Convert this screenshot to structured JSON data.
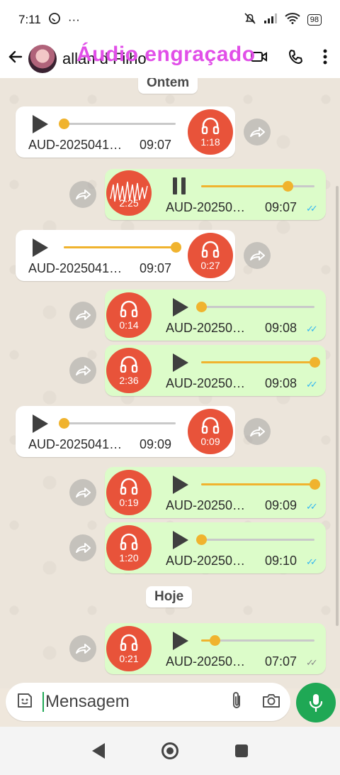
{
  "status_bar": {
    "time": "7:11",
    "dots": "···",
    "battery": "98"
  },
  "header": {
    "contact_name": "allan d Filho",
    "overlay_title": "Áudio engraçado"
  },
  "date_chips": {
    "yesterday": "Ontem",
    "today": "Hoje"
  },
  "messages": [
    {
      "direction": "in",
      "file": "AUD-2025041…",
      "time": "09:07",
      "duration": "1:18",
      "progress": 0.0,
      "state": "stopped"
    },
    {
      "direction": "out",
      "file": "AUD-20250…",
      "time": "09:07",
      "duration": "2:25",
      "progress": 0.76,
      "state": "playing",
      "read": true
    },
    {
      "direction": "in",
      "file": "AUD-2025041…",
      "time": "09:07",
      "duration": "0:27",
      "progress": 1.0,
      "state": "stopped"
    },
    {
      "direction": "out",
      "file": "AUD-20250…",
      "time": "09:08",
      "duration": "0:14",
      "progress": 0.0,
      "state": "stopped",
      "read": true
    },
    {
      "direction": "out",
      "file": "AUD-20250…",
      "time": "09:08",
      "duration": "2:36",
      "progress": 1.0,
      "state": "stopped",
      "read": true
    },
    {
      "direction": "in",
      "file": "AUD-2025041…",
      "time": "09:09",
      "duration": "0:09",
      "progress": 0.0,
      "state": "stopped"
    },
    {
      "direction": "out",
      "file": "AUD-20250…",
      "time": "09:09",
      "duration": "0:19",
      "progress": 1.0,
      "state": "stopped",
      "read": true
    },
    {
      "direction": "out",
      "file": "AUD-20250…",
      "time": "09:10",
      "duration": "1:20",
      "progress": 0.0,
      "state": "stopped",
      "read": true
    },
    {
      "direction": "out",
      "file": "AUD-20250…",
      "time": "07:07",
      "duration": "0:21",
      "progress": 0.12,
      "state": "stopped",
      "read": false
    }
  ],
  "composer": {
    "placeholder": "Mensagem"
  },
  "colors": {
    "accent": "#1fa855",
    "headphone_badge": "#e8533a",
    "progress": "#f0b32e",
    "read_ticks": "#34b7f1"
  }
}
